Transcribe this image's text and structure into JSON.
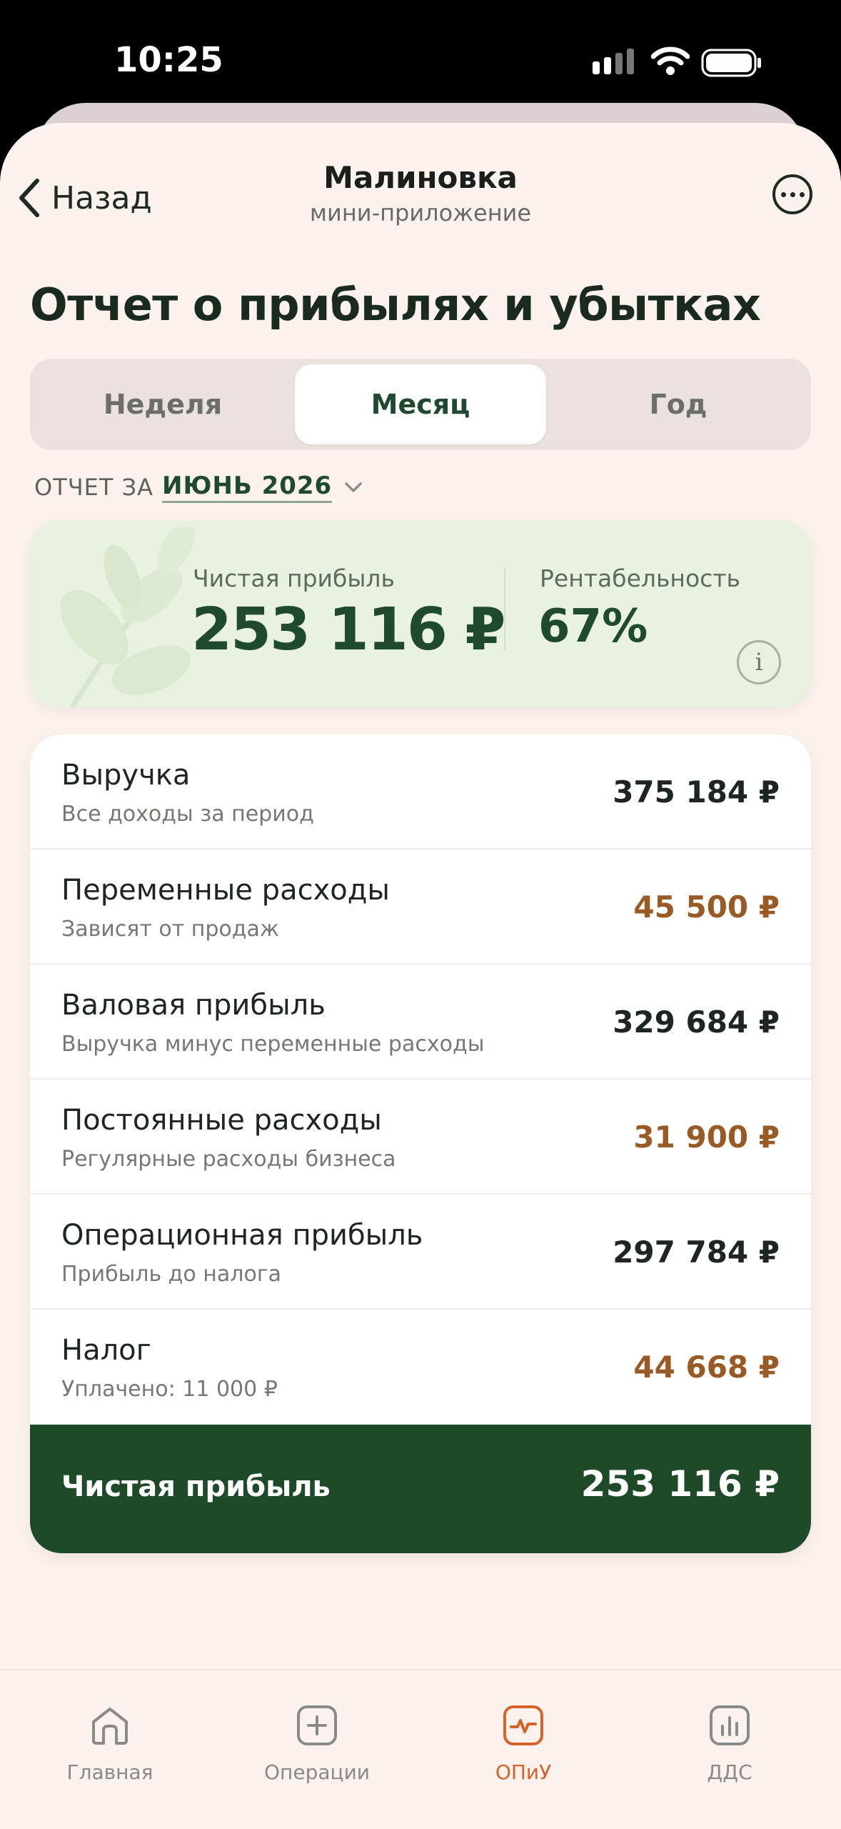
{
  "status": {
    "time": "10:25"
  },
  "nav": {
    "back_label": "Назад",
    "title": "Малиновка",
    "subtitle": "мини-приложение"
  },
  "page": {
    "title": "Отчет о прибылях и убытках"
  },
  "periods": {
    "week": "Неделя",
    "month": "Месяц",
    "year": "Год",
    "selected": "Месяц"
  },
  "report_period": {
    "label": "ОТЧЕТ ЗА",
    "value": "ИЮНЬ 2026"
  },
  "summary": {
    "net_profit_label": "Чистая прибыль",
    "net_profit_value": "253 116 ₽",
    "margin_label": "Рентабельность",
    "margin_value": "67%",
    "info_label": "i"
  },
  "rows": [
    {
      "title": "Выручка",
      "subtitle": "Все доходы за период",
      "value": "375 184 ₽",
      "kind": "income"
    },
    {
      "title": "Переменные расходы",
      "subtitle": "Зависят от продаж",
      "value": "45 500 ₽",
      "kind": "expense"
    },
    {
      "title": "Валовая прибыль",
      "subtitle": "Выручка минус переменные расходы",
      "value": "329 684 ₽",
      "kind": "income"
    },
    {
      "title": "Постоянные расходы",
      "subtitle": "Регулярные расходы бизнеса",
      "value": "31 900 ₽",
      "kind": "expense"
    },
    {
      "title": "Операционная прибыль",
      "subtitle": "Прибыль до налога",
      "value": "297 784 ₽",
      "kind": "income"
    },
    {
      "title": "Налог",
      "subtitle": "Уплачено: 11 000 ₽",
      "value": "44 668 ₽",
      "kind": "expense"
    }
  ],
  "total": {
    "label": "Чистая прибыль",
    "value": "253 116 ₽"
  },
  "tabs": {
    "home": "Главная",
    "operations": "Операции",
    "pnl": "ОПиУ",
    "dds": "ДДС",
    "active": "ОПиУ"
  },
  "colors": {
    "accent_green": "#1f4a2a",
    "expense_brown": "#9a5a26",
    "active_tab": "#d6622a",
    "background": "#fbf1ed"
  }
}
